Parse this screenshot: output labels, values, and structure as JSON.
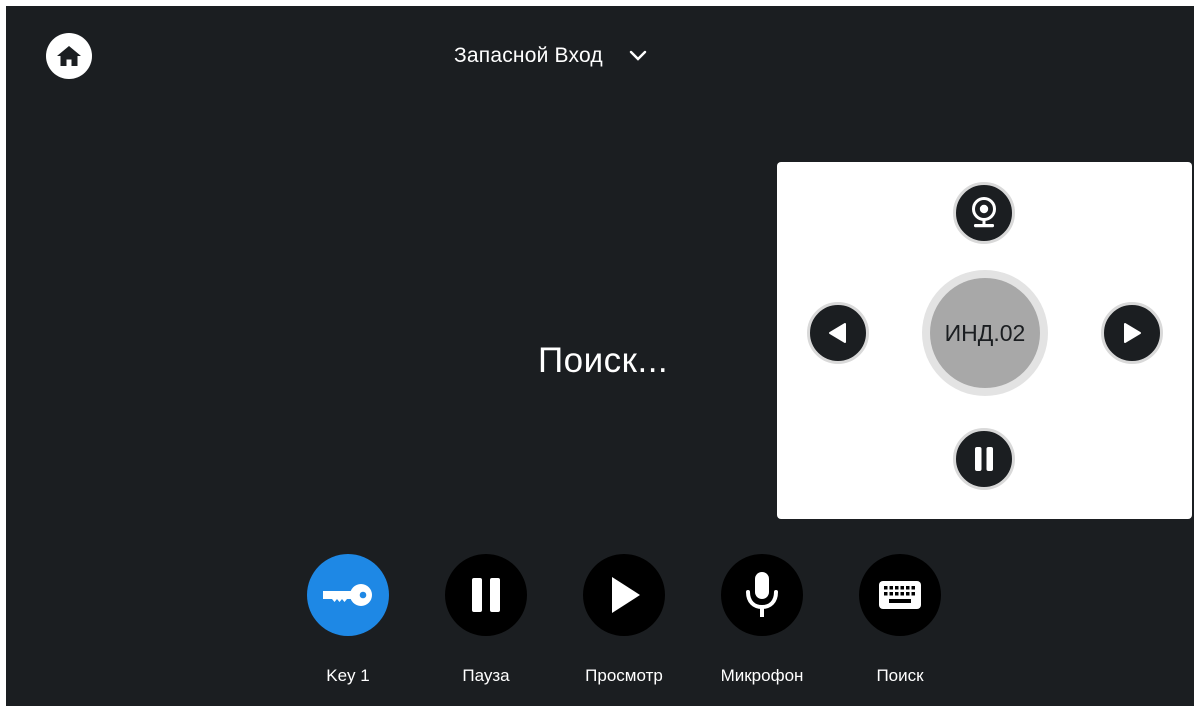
{
  "header": {
    "source_name": "Запасной Вход"
  },
  "status": {
    "text": "Поиск..."
  },
  "ptz": {
    "preset_label": "ИНД.02"
  },
  "actions": [
    {
      "label": "Key 1",
      "icon": "key-icon",
      "color": "#1e88e5"
    },
    {
      "label": "Пауза",
      "icon": "pause-icon",
      "color": "#000000"
    },
    {
      "label": "Просмотр",
      "icon": "play-icon",
      "color": "#000000"
    },
    {
      "label": "Микрофон",
      "icon": "microphone-icon",
      "color": "#000000"
    },
    {
      "label": "Поиск",
      "icon": "keyboard-icon",
      "color": "#000000"
    }
  ],
  "colors": {
    "background": "#1b1e21",
    "accent": "#1e88e5",
    "panel": "#ffffff"
  }
}
